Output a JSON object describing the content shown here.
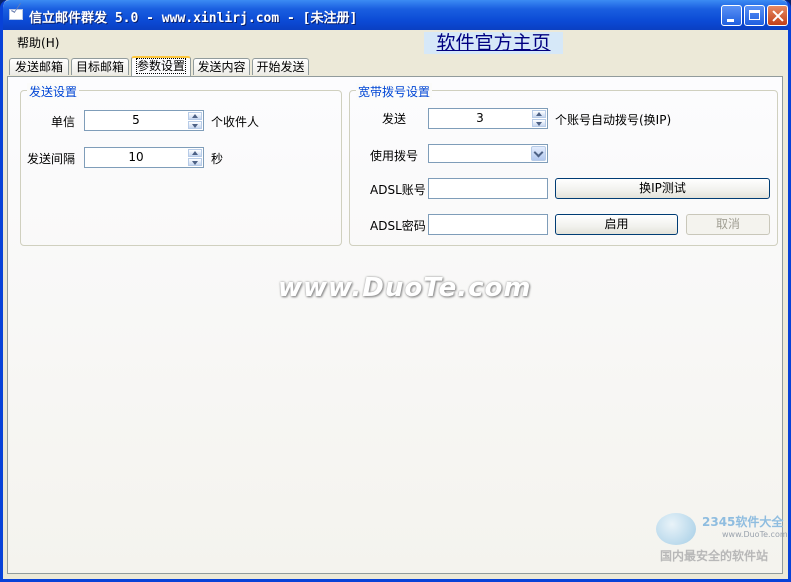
{
  "window": {
    "title": "信立邮件群发 5.0 - www.xinlirj.com - [未注册]"
  },
  "menu": {
    "help_label": "帮助",
    "help_accel": "(H)"
  },
  "homepage_link": "软件官方主页",
  "tabs": [
    {
      "label": "发送邮箱",
      "active": false
    },
    {
      "label": "目标邮箱",
      "active": false
    },
    {
      "label": "参数设置",
      "active": true
    },
    {
      "label": "发送内容",
      "active": false
    },
    {
      "label": "开始发送",
      "active": false
    }
  ],
  "send_settings": {
    "title": "发送设置",
    "single_label": "单信",
    "single_value": "5",
    "single_unit": "个收件人",
    "interval_label": "发送间隔",
    "interval_value": "10",
    "interval_unit": "秒"
  },
  "dialup_settings": {
    "title": "宽带拨号设置",
    "send_label": "发送",
    "send_value": "3",
    "send_unit": "个账号自动拨号(换IP)",
    "use_dialup_label": "使用拨号",
    "use_dialup_value": "",
    "adsl_account_label": "ADSL账号",
    "adsl_account_value": "",
    "test_button": "换IP测试",
    "adsl_password_label": "ADSL密码",
    "adsl_password_value": "",
    "enable_button": "启用",
    "cancel_button": "取消"
  },
  "watermark": "www.DuoTe.com",
  "corner_logo": {
    "brand": "2345软件大全",
    "url": "www.DuoTe.com",
    "slogan": "国内最安全的软件站"
  }
}
